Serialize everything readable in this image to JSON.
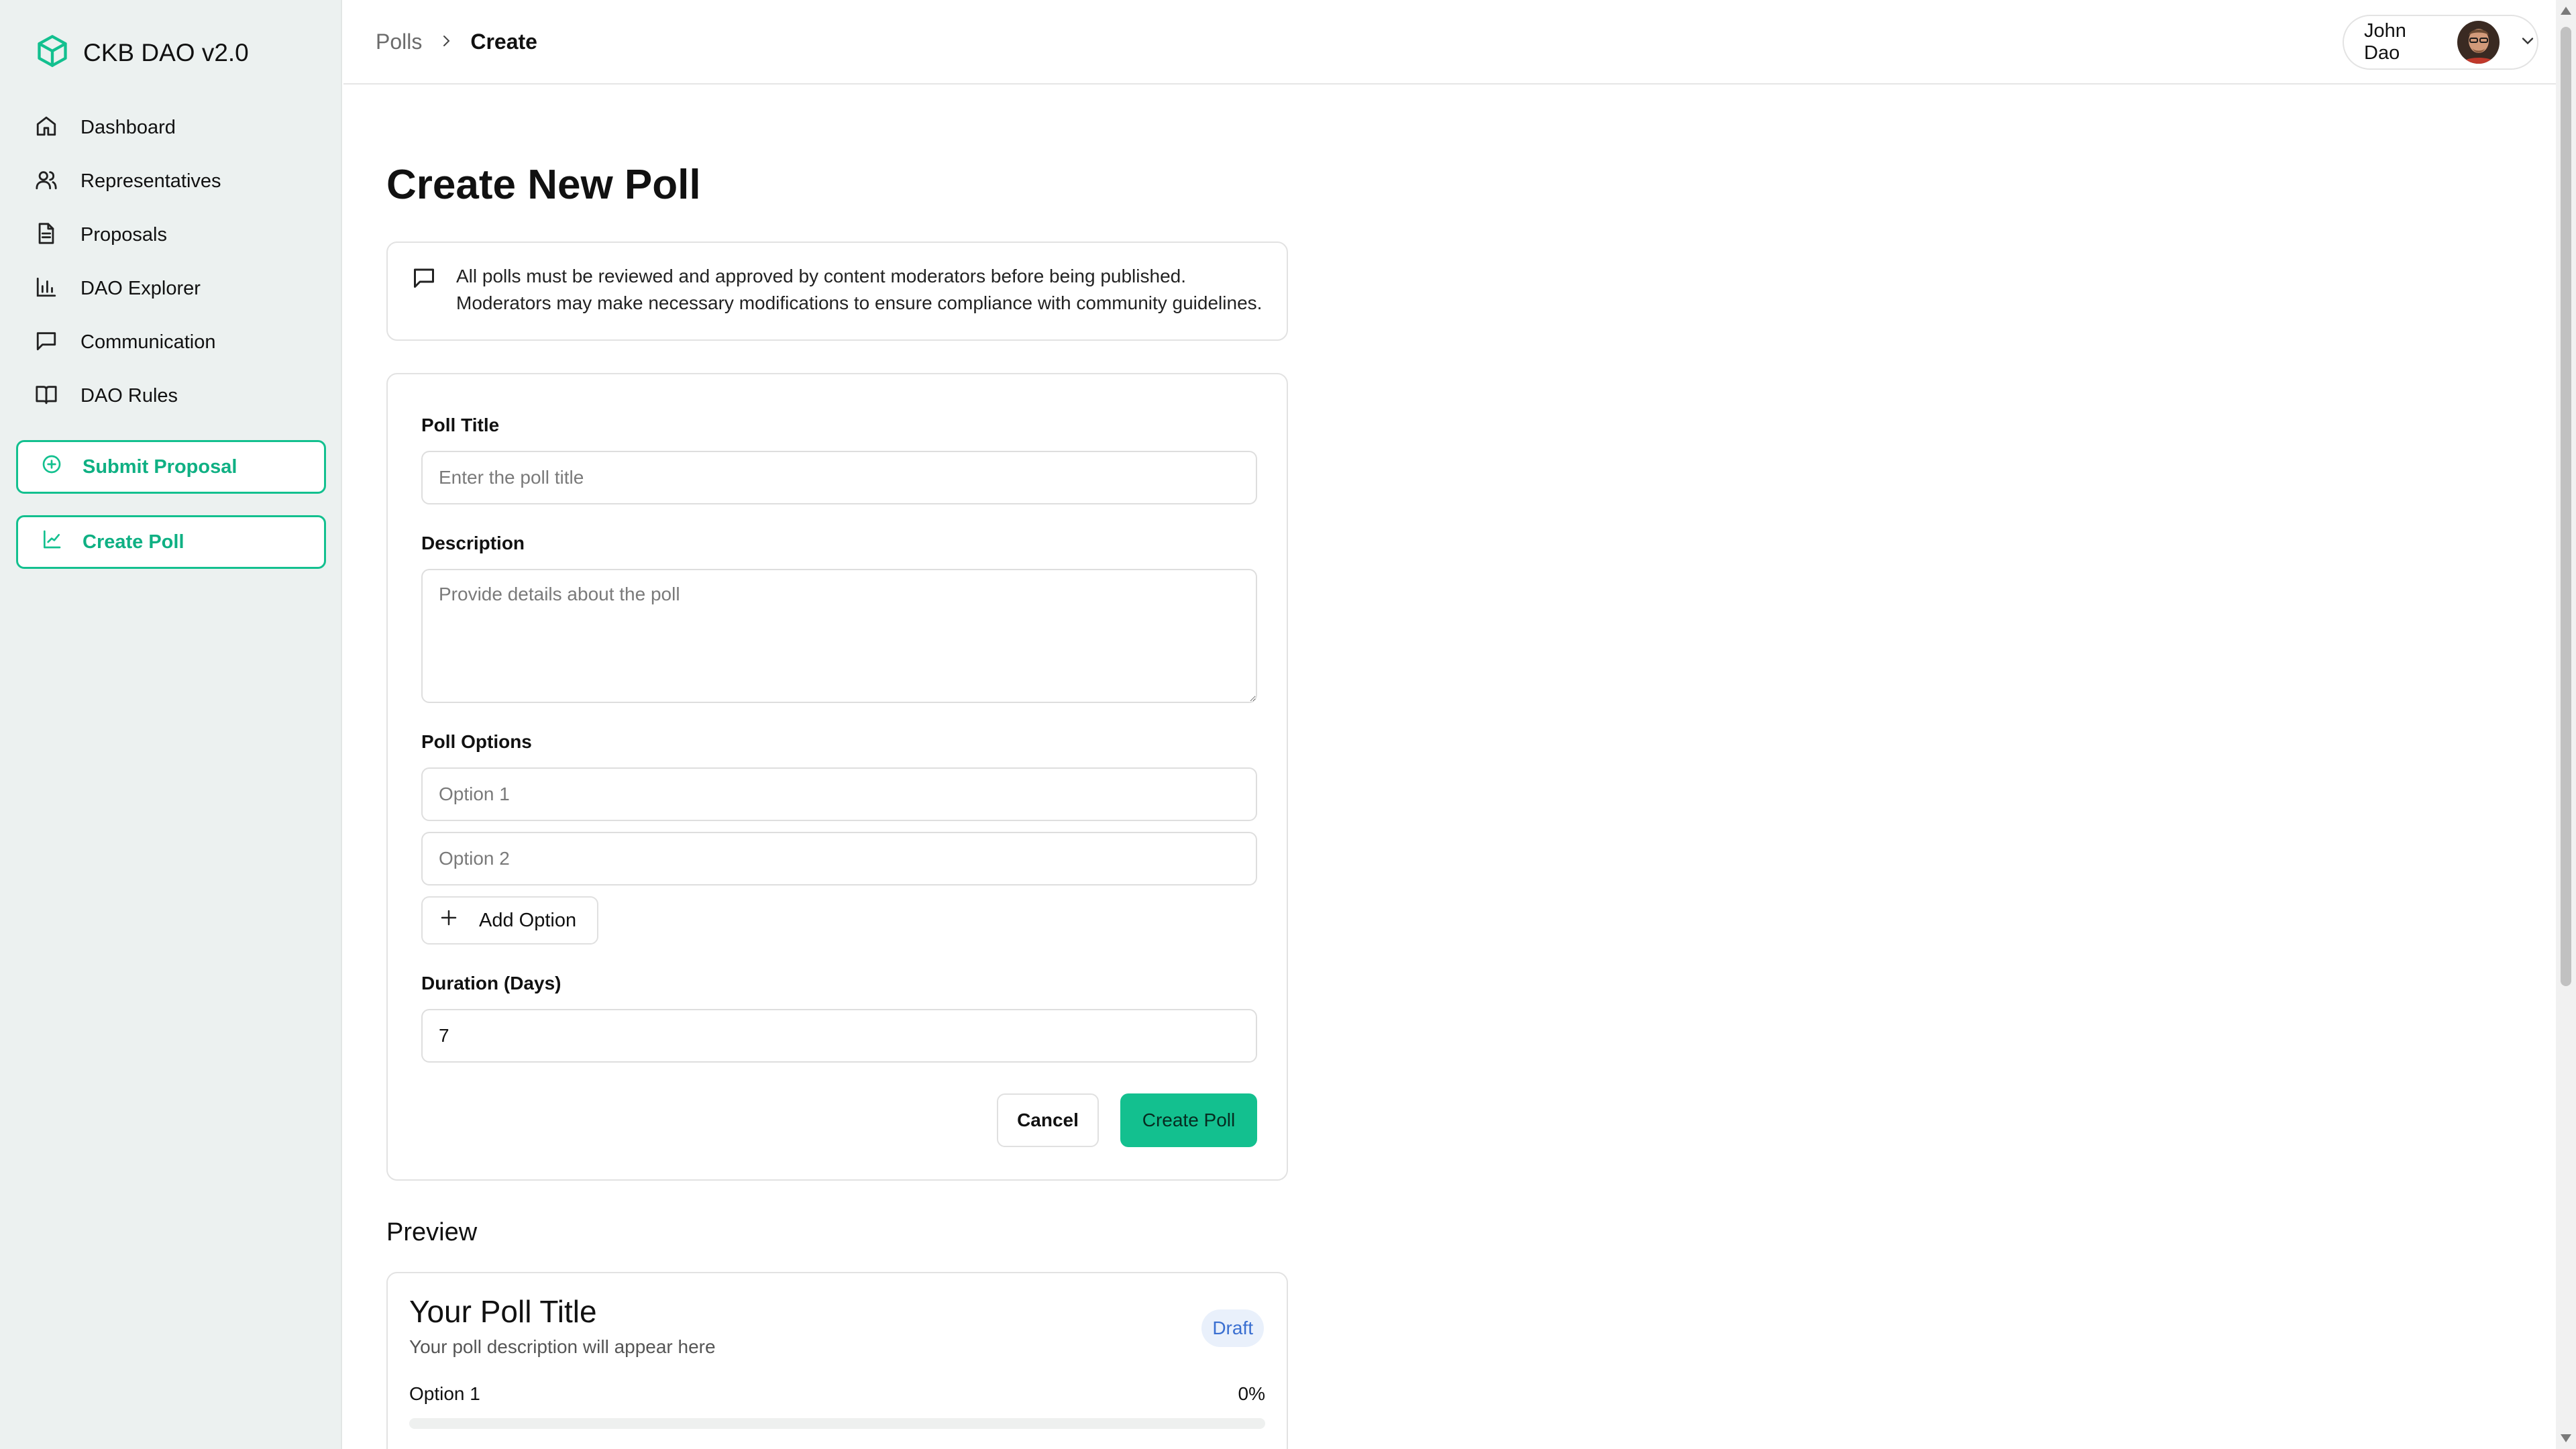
{
  "app": {
    "title": "CKB DAO v2.0",
    "accent_color": "#13c08f"
  },
  "sidebar": {
    "items": [
      {
        "label": "Dashboard",
        "icon": "home-icon"
      },
      {
        "label": "Representatives",
        "icon": "users-icon"
      },
      {
        "label": "Proposals",
        "icon": "document-icon"
      },
      {
        "label": "DAO Explorer",
        "icon": "bar-chart-icon"
      },
      {
        "label": "Communication",
        "icon": "message-icon"
      },
      {
        "label": "DAO Rules",
        "icon": "book-icon"
      }
    ],
    "submit_proposal": "Submit Proposal",
    "create_poll": "Create Poll"
  },
  "header": {
    "breadcrumb": {
      "parent": "Polls",
      "current": "Create"
    },
    "user_name": "John Dao"
  },
  "page": {
    "title": "Create New Poll",
    "notice": "All polls must be reviewed and approved by content moderators before being published. Moderators may make necessary modifications to ensure compliance with community guidelines."
  },
  "form": {
    "title_label": "Poll Title",
    "title_placeholder": "Enter the poll title",
    "description_label": "Description",
    "description_placeholder": "Provide details about the poll",
    "options_label": "Poll Options",
    "option1_placeholder": "Option 1",
    "option2_placeholder": "Option 2",
    "add_option": "Add Option",
    "duration_label": "Duration (Days)",
    "duration_value": "7",
    "cancel": "Cancel",
    "submit": "Create Poll"
  },
  "preview": {
    "heading": "Preview",
    "title": "Your Poll Title",
    "description": "Your poll description will appear here",
    "badge": "Draft",
    "options": [
      {
        "label": "Option 1",
        "percent_text": "0%",
        "percent": 0
      }
    ]
  }
}
